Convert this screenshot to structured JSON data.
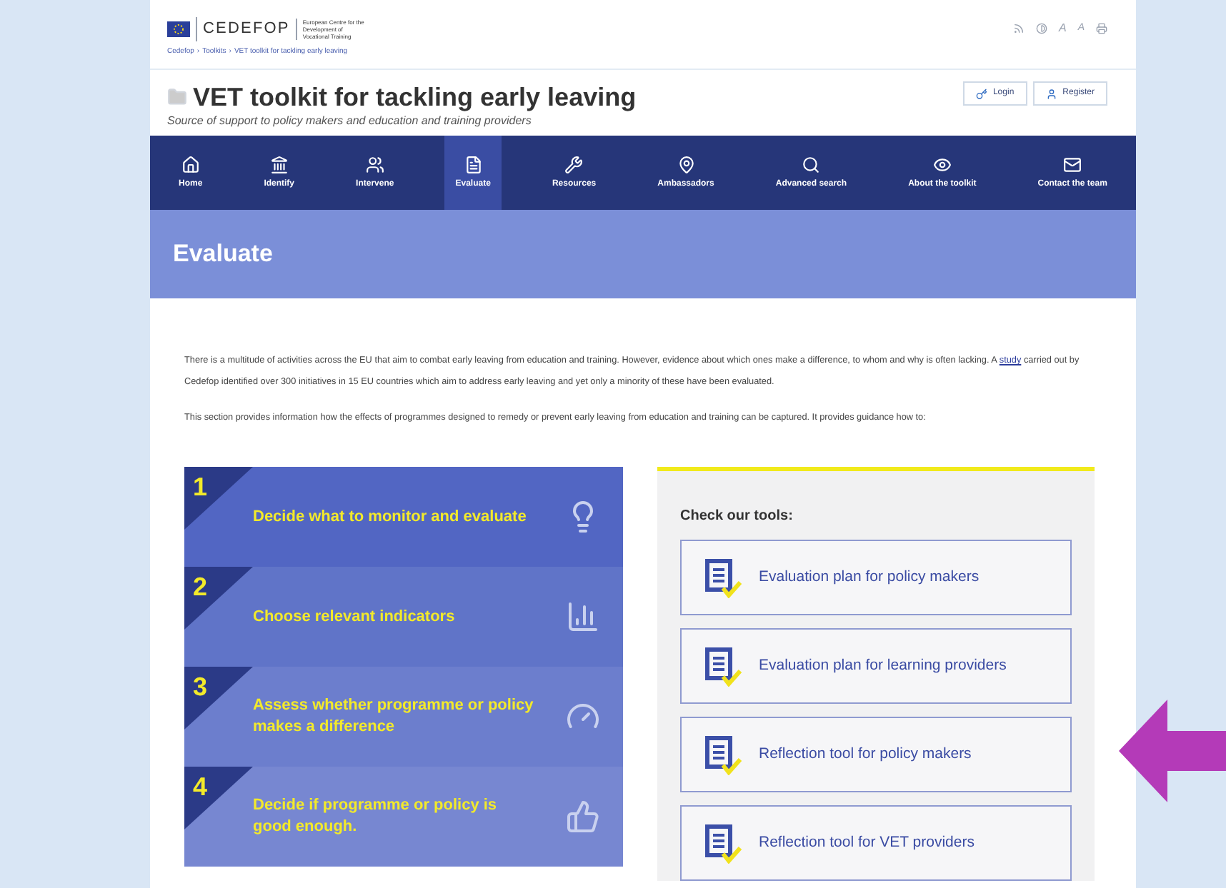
{
  "header": {
    "logo_text": "CEDEFOP",
    "logo_subtitle": "European Centre for the Development of Vocational Training",
    "breadcrumb": [
      "Cedefop",
      "Toolkits",
      "VET toolkit for tackling early leaving"
    ],
    "breadcrumb_separator": "›",
    "font_size_labels": [
      "A",
      "A"
    ]
  },
  "site": {
    "title": "VET toolkit for tackling early leaving",
    "subtitle": "Source of support to policy makers and education and training providers",
    "actions": [
      {
        "kind": "login",
        "label": "Login"
      },
      {
        "kind": "register",
        "label": "Register"
      }
    ]
  },
  "nav": [
    {
      "kind": "home",
      "label": "Home",
      "selected": false
    },
    {
      "kind": "identify",
      "label": "Identify",
      "selected": false
    },
    {
      "kind": "intervene",
      "label": "Intervene",
      "selected": false
    },
    {
      "kind": "evaluate",
      "label": "Evaluate",
      "selected": true
    },
    {
      "kind": "resources",
      "label": "Resources",
      "selected": false
    },
    {
      "kind": "ambassadors",
      "label": "Ambassadors",
      "selected": false
    },
    {
      "kind": "search",
      "label": "Advanced search",
      "selected": false
    },
    {
      "kind": "about",
      "label": "About the toolkit",
      "selected": false
    },
    {
      "kind": "contact",
      "label": "Contact the team",
      "selected": false
    }
  ],
  "banner": {
    "title": "Evaluate"
  },
  "intro": {
    "paragraph_1_before": "There is a multitude of activities across the EU that aim to combat early leaving from education and training. However, evidence about which ones make a difference, to whom and why is often lacking. A",
    "link": "study",
    "paragraph_1_after": "carried out by Cedefop identified over 300 initiatives in 15 EU countries which aim to address early leaving and yet only a minority of these have been evaluated.",
    "paragraph_2": "This section provides information how the effects of programmes designed to remedy or prevent early leaving from education and training can be captured. It provides guidance how to:"
  },
  "steps": [
    {
      "number": "1",
      "text": "Decide what to monitor and evaluate",
      "kind": "monitor"
    },
    {
      "number": "2",
      "text": "Choose relevant indicators",
      "kind": "indicators"
    },
    {
      "number": "3",
      "text": "Assess whether programme or policy makes a difference",
      "kind": "assess"
    },
    {
      "number": "4",
      "text": "Decide if programme or policy is good enough.",
      "kind": "decide"
    }
  ],
  "tools": {
    "heading": "Check our tools:",
    "items": [
      "Evaluation plan for policy makers",
      "Evaluation plan for learning providers",
      "Reflection tool for policy makers",
      "Reflection tool for VET providers"
    ]
  }
}
